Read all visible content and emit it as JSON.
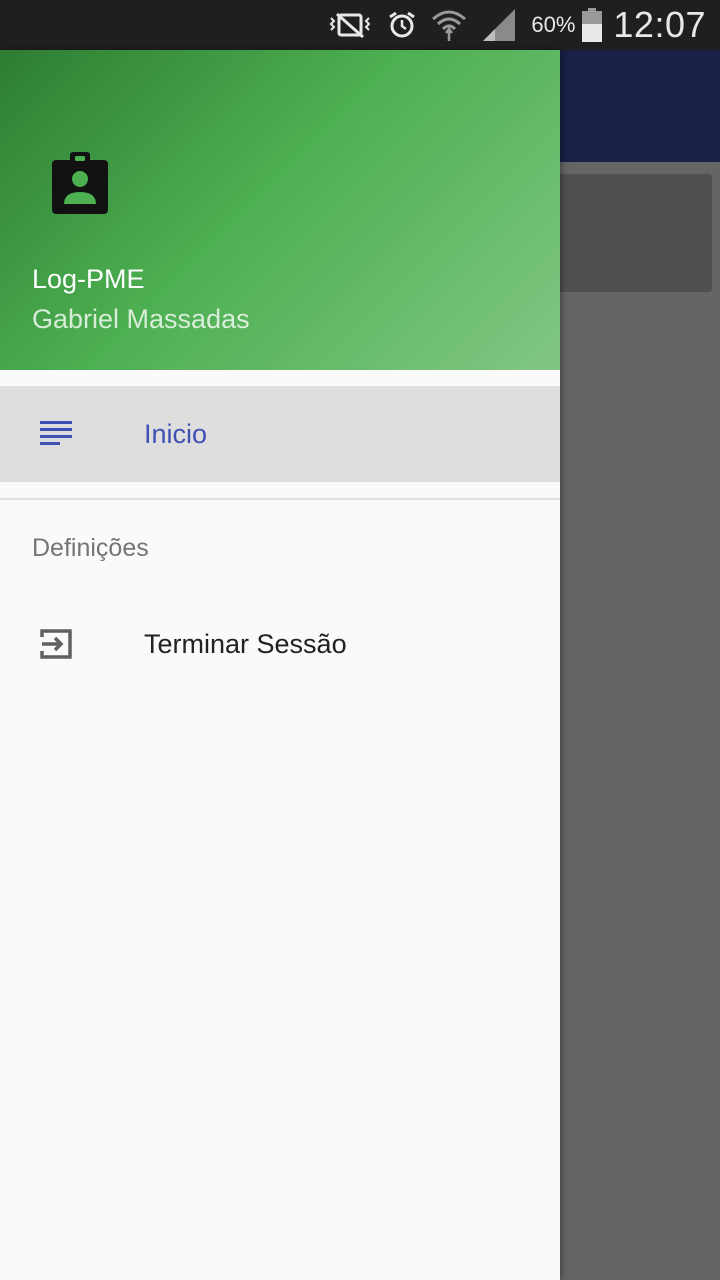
{
  "status_bar": {
    "battery_percent": "60%",
    "time": "12:07",
    "icons": [
      "vibrate-icon",
      "alarm-icon",
      "wifi-icon",
      "signal-icon",
      "battery-icon"
    ]
  },
  "drawer": {
    "header": {
      "icon": "badge-icon",
      "title": "Log-PME",
      "subtitle": "Gabriel Massadas",
      "gradient_colors": [
        "#2e7d32",
        "#4caf50",
        "#81c784"
      ]
    },
    "items": [
      {
        "label": "Inicio",
        "icon": "list-icon",
        "selected": true
      }
    ],
    "section_title": "Definições",
    "settings_items": [
      {
        "label": "Terminar Sessão",
        "icon": "logout-icon"
      }
    ]
  },
  "colors": {
    "accent": "#3f51b5",
    "toolbar": "#1a2048",
    "scrim": "#656565"
  }
}
